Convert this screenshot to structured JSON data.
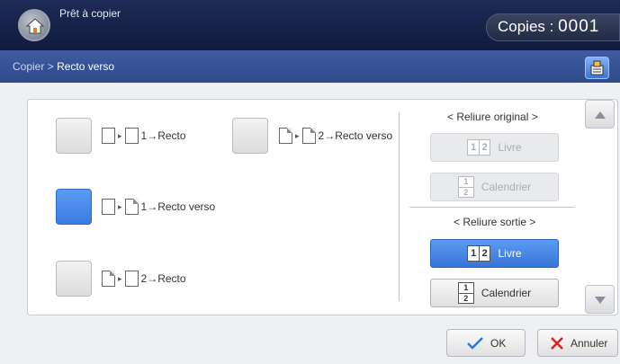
{
  "header": {
    "status": "Prêt à copier",
    "copies_label": "Copies :",
    "copies_value": "0001"
  },
  "breadcrumb": {
    "parent": "Copier",
    "separator": ">",
    "current": "Recto verso"
  },
  "options": [
    {
      "label": "1→Recto",
      "selected": false
    },
    {
      "label": "2→Recto verso",
      "selected": false
    },
    {
      "label": "1→Recto verso",
      "selected": true
    },
    {
      "label": "2→Recto",
      "selected": false
    }
  ],
  "binding_original": {
    "title": "< Reliure original >",
    "book_label": "Livre",
    "book_digits": [
      "1",
      "2"
    ],
    "calendar_label": "Calendrier",
    "calendar_digits": [
      "1",
      "2"
    ]
  },
  "binding_output": {
    "title": "< Reliure sortie >",
    "book_label": "Livre",
    "book_digits": [
      "1",
      "2"
    ],
    "calendar_label": "Calendrier",
    "calendar_digits": [
      "1",
      "2"
    ]
  },
  "footer": {
    "ok_label": "OK",
    "cancel_label": "Annuler"
  },
  "colors": {
    "selected": "#3b7be0",
    "header": "#0f1a3d",
    "breadcrumb_bar": "#2e4a8a",
    "ok_check": "#2a7ad8",
    "cancel_x": "#d82020"
  }
}
